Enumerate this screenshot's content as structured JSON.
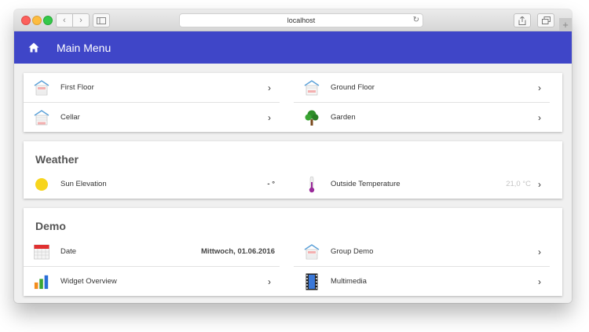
{
  "browser": {
    "url": "localhost"
  },
  "appbar": {
    "title": "Main Menu"
  },
  "rooms": [
    {
      "label": "First Floor",
      "icon": "house-icon"
    },
    {
      "label": "Ground Floor",
      "icon": "house-icon"
    },
    {
      "label": "Cellar",
      "icon": "house-icon"
    },
    {
      "label": "Garden",
      "icon": "tree-icon"
    }
  ],
  "weather": {
    "title": "Weather",
    "sun_label": "Sun Elevation",
    "sun_value": "- °",
    "temp_label": "Outside Temperature",
    "temp_value": "21,0 °C"
  },
  "demo": {
    "title": "Demo",
    "date_label": "Date",
    "date_value": "Mittwoch, 01.06.2016",
    "group_label": "Group Demo",
    "widget_label": "Widget Overview",
    "multimedia_label": "Multimedia"
  },
  "colors": {
    "appbar": "#3f46c8"
  }
}
